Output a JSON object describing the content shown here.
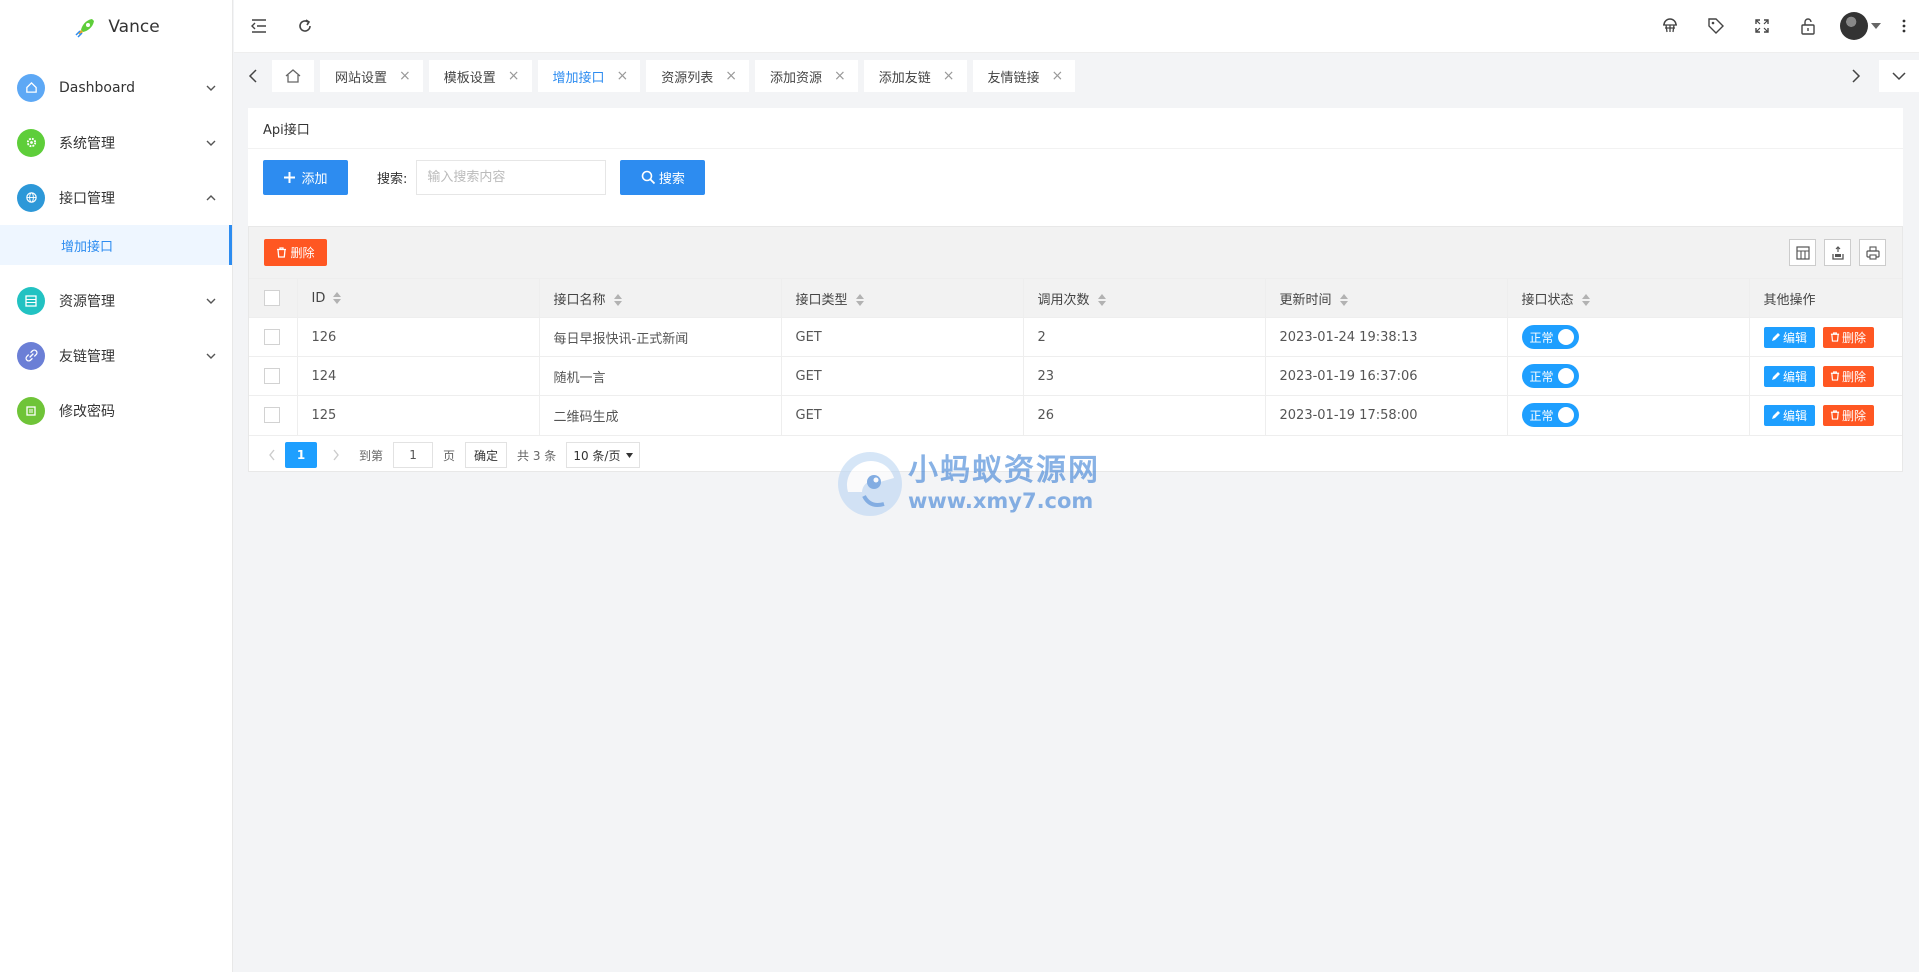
{
  "app": {
    "name": "Vance"
  },
  "sidebar": {
    "items": [
      {
        "label": "Dashboard",
        "icon": "home-icon",
        "color": "#5da8f5"
      },
      {
        "label": "系统管理",
        "icon": "gear-icon",
        "color": "#5ece3a"
      },
      {
        "label": "接口管理",
        "icon": "globe-icon",
        "color": "#2d98d8",
        "expanded": true
      },
      {
        "label": "资源管理",
        "icon": "grid-icon",
        "color": "#22c2c2"
      },
      {
        "label": "友链管理",
        "icon": "link-icon",
        "color": "#6b7fd6"
      },
      {
        "label": "修改密码",
        "icon": "key-icon",
        "color": "#6fc438"
      }
    ],
    "sub_item_active": "增加接口"
  },
  "header": {
    "icons": [
      "menu-collapse-icon",
      "refresh-icon",
      "clear-cache-icon",
      "tag-icon",
      "fullscreen-icon",
      "lock-icon",
      "avatar",
      "more-icon"
    ]
  },
  "tabs": [
    {
      "label": "网站设置"
    },
    {
      "label": "模板设置"
    },
    {
      "label": "增加接口",
      "active": true
    },
    {
      "label": "资源列表"
    },
    {
      "label": "添加资源"
    },
    {
      "label": "添加友链"
    },
    {
      "label": "友情链接"
    }
  ],
  "card": {
    "title": "Api接口",
    "add_label": "添加",
    "search_label": "搜索:",
    "search_placeholder": "输入搜索内容",
    "search_button": "搜索"
  },
  "table": {
    "delete_label": "删除",
    "columns": [
      "ID",
      "接口名称",
      "接口类型",
      "调用次数",
      "更新时间",
      "接口状态",
      "其他操作"
    ],
    "rows": [
      {
        "id": "126",
        "name": "每日早报快讯-正式新闻",
        "type": "GET",
        "calls": "2",
        "updated": "2023-01-24 19:38:13",
        "status": "正常"
      },
      {
        "id": "124",
        "name": "随机一言",
        "type": "GET",
        "calls": "23",
        "updated": "2023-01-19 16:37:06",
        "status": "正常"
      },
      {
        "id": "125",
        "name": "二维码生成",
        "type": "GET",
        "calls": "26",
        "updated": "2023-01-19 17:58:00",
        "status": "正常"
      }
    ],
    "edit_label": "编辑",
    "row_delete_label": "删除"
  },
  "pager": {
    "current_page": "1",
    "goto_label": "到第",
    "goto_value": "1",
    "page_unit": "页",
    "confirm": "确定",
    "total": "共 3 条",
    "page_size": "10 条/页"
  },
  "watermark": {
    "line1": "小蚂蚁资源网",
    "line2": "www.xmy7.com"
  },
  "colors": {
    "primary": "#2d8cf0",
    "danger": "#ff5722",
    "switch_on": "#1e9fff"
  }
}
